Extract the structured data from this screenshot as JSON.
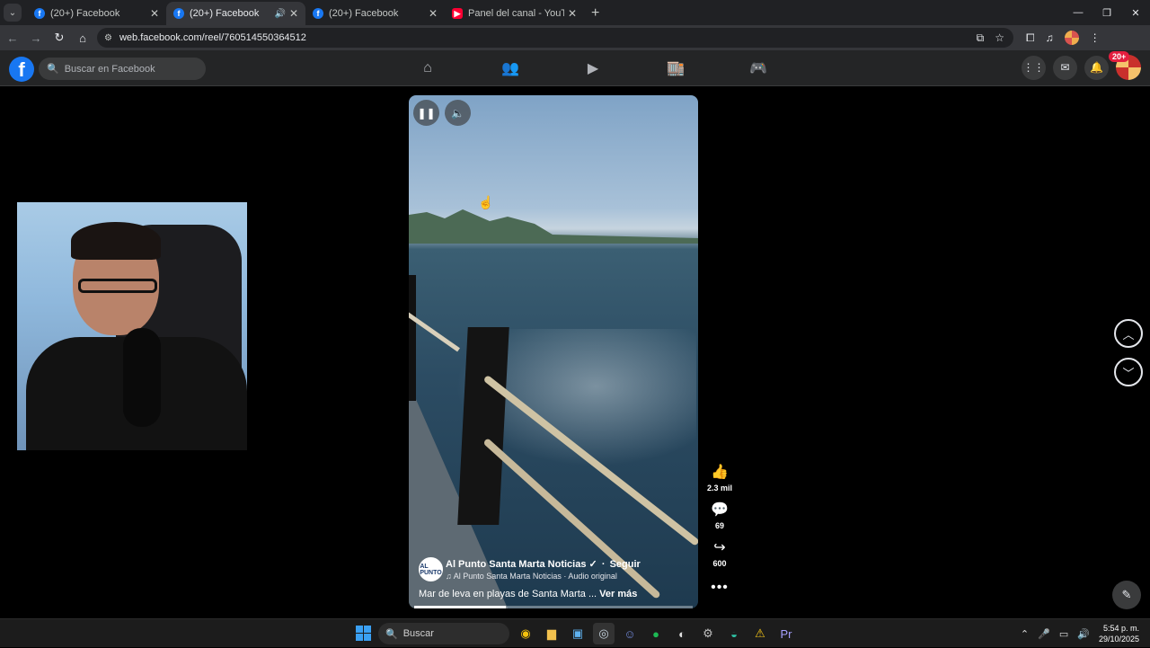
{
  "browser": {
    "tabs": [
      {
        "label": "(20+) Facebook",
        "favicon": "facebook-icon",
        "active": false
      },
      {
        "label": "(20+) Facebook",
        "favicon": "facebook-icon",
        "active": true
      },
      {
        "label": "(20+) Facebook",
        "favicon": "facebook-icon",
        "active": false
      },
      {
        "label": "Panel del canal - YouTube Studio",
        "favicon": "youtube-icon",
        "active": false
      }
    ],
    "url": "web.facebook.com/reel/760514550364512"
  },
  "facebook": {
    "logo_letter": "f",
    "search_placeholder": "Buscar en Facebook",
    "notifications_badge": "20+"
  },
  "reel": {
    "page_avatar_text": "AL PUNTO",
    "author": "Al Punto Santa Marta Noticias",
    "verified_icon": "verified-icon",
    "follow": "Seguir",
    "audio": "Al Punto Santa Marta Noticias · Audio original",
    "caption": "Mar de leva en  playas de Santa Marta ...",
    "see_more": "Ver más",
    "progress": 0.33,
    "likes": "2.3 mil",
    "comments": "69",
    "shares": "600"
  },
  "taskbar": {
    "search_placeholder": "Buscar",
    "time": "5:54 p. m.",
    "date": "29/10/2025"
  },
  "colors": {
    "facebook_blue": "#1877f2",
    "header_bg": "#242526",
    "badge_red": "#e41e3f"
  }
}
